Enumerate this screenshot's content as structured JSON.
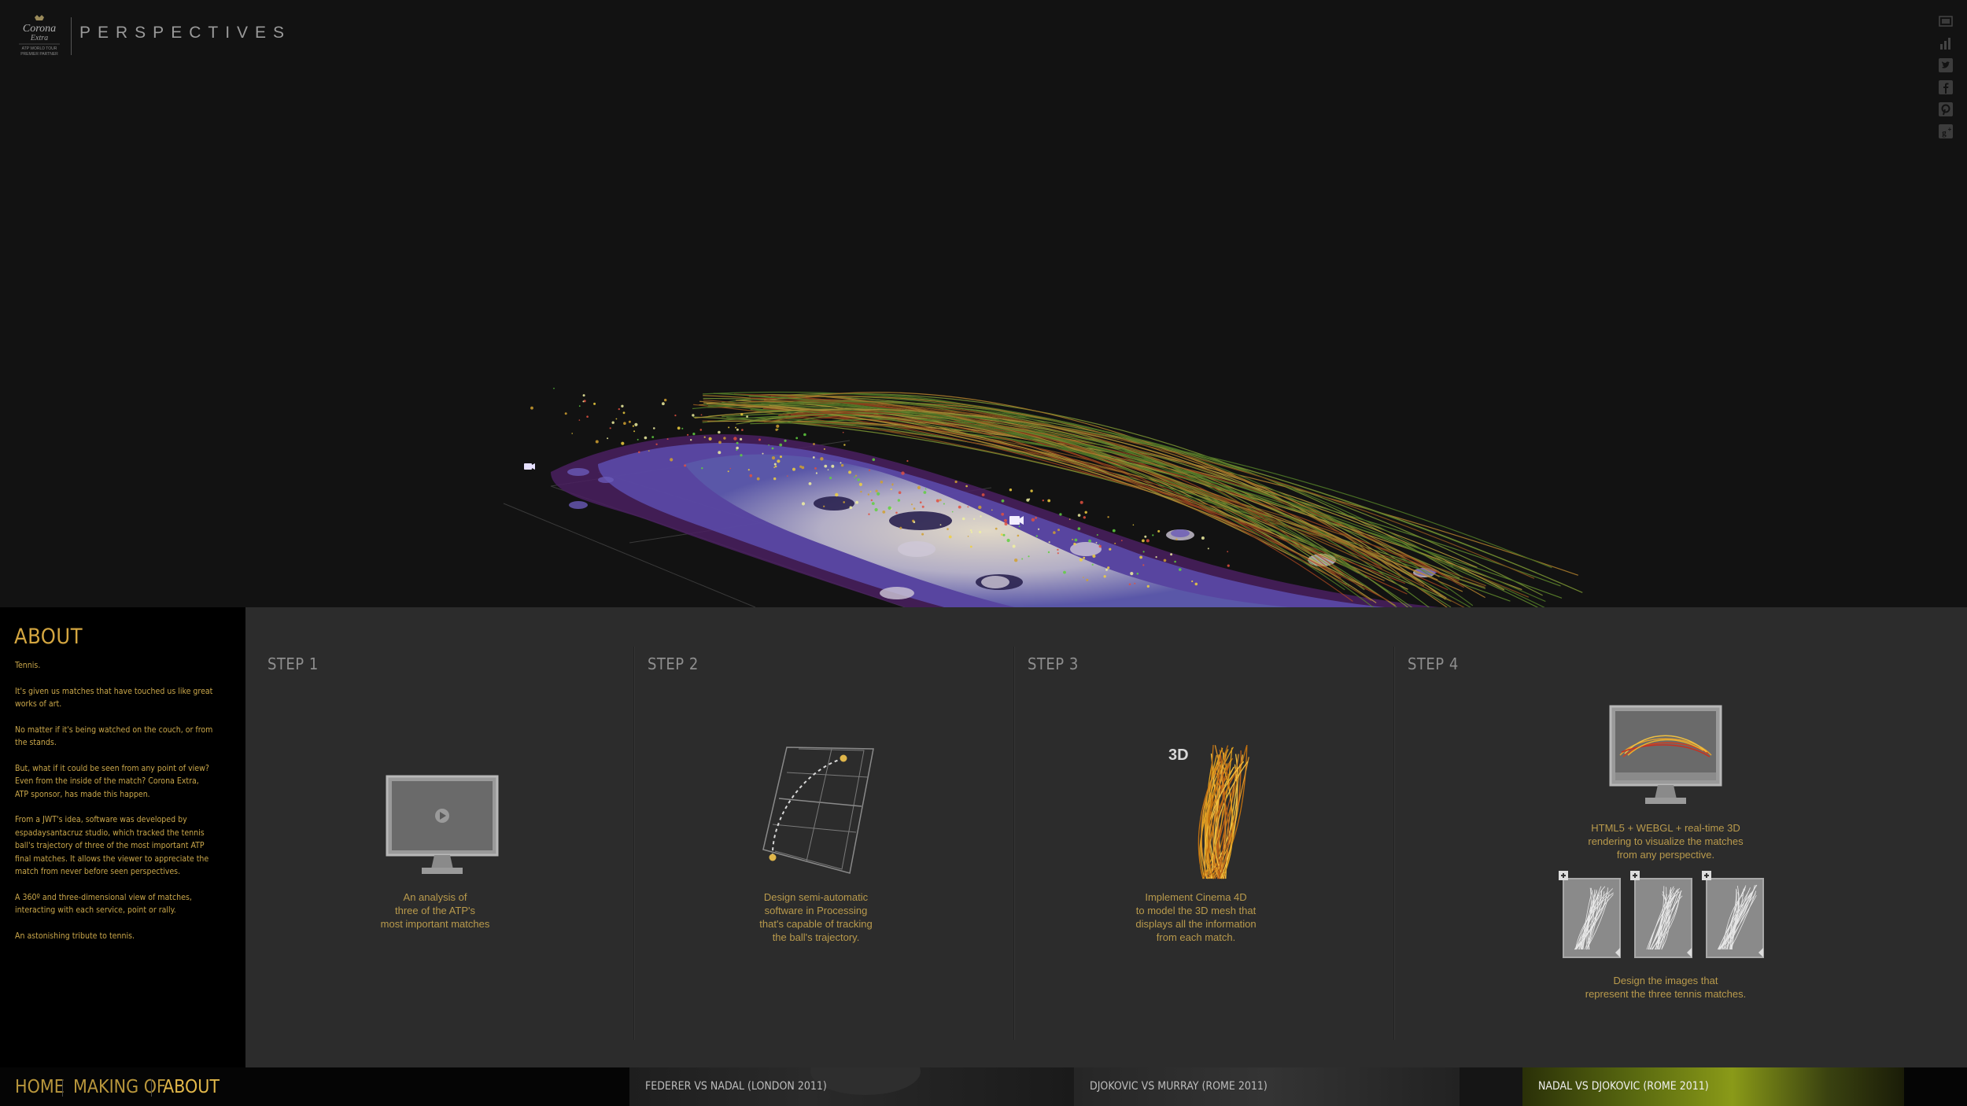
{
  "header": {
    "logo_lines": [
      "Corona",
      "Extra",
      "ATP WORLD TOUR",
      "PREMIER PARTNER"
    ],
    "brand": "PERSPECTIVES"
  },
  "rail_icons": [
    "fullscreen-icon",
    "stats-icon",
    "twitter-icon",
    "facebook-icon",
    "pinterest-icon",
    "google-plus-icon"
  ],
  "about": {
    "title": "ABOUT",
    "paragraphs": [
      "Tennis.",
      "It's given us matches that have touched us like great works of art.",
      "No matter if it's being watched on the couch, or from the stands.",
      "But, what if it could be seen from any point of view? Even from the inside of the match? Corona Extra, ATP sponsor, has made this happen.",
      "From a JWT's idea, software was developed by espadaysantacruz studio, which tracked the tennis ball's trajectory of three of the most important ATP final matches. It allows the viewer to appreciate the match from never before seen perspectives.",
      "A 360º and three-dimensional view of matches, interacting with each service, point or rally.",
      "An astonishing tribute to tennis."
    ]
  },
  "steps": [
    {
      "title": "STEP 1",
      "caption": "An analysis of\nthree of the ATP's\nmost important matches"
    },
    {
      "title": "STEP 2",
      "caption": "Design semi-automatic\nsoftware in Processing\nthat's capable of tracking\nthe ball's trajectory."
    },
    {
      "title": "STEP 3",
      "caption": "Implement Cinema 4D\nto model the 3D mesh that\ndisplays all the information\nfrom each match.",
      "badge": "3D"
    },
    {
      "title": "STEP 4",
      "caption_top": "HTML5 + WEBGL + real-time 3D\nrendering to visualize the matches\nfrom any perspective.",
      "caption_bottom": "Design the images that\nrepresent the three tennis matches."
    }
  ],
  "nav": {
    "home": "HOME",
    "making_of": "MAKING OF",
    "about": "ABOUT"
  },
  "matches": [
    "FEDERER VS NADAL (LONDON 2011)",
    "DJOKOVIC VS MURRAY (ROME 2011)",
    "NADAL VS DJOKOVIC (ROME 2011)"
  ],
  "colors": {
    "accent": "#d4a640",
    "caption": "#b99a4c",
    "panel": "#2c2c2c",
    "bg": "#121212"
  }
}
